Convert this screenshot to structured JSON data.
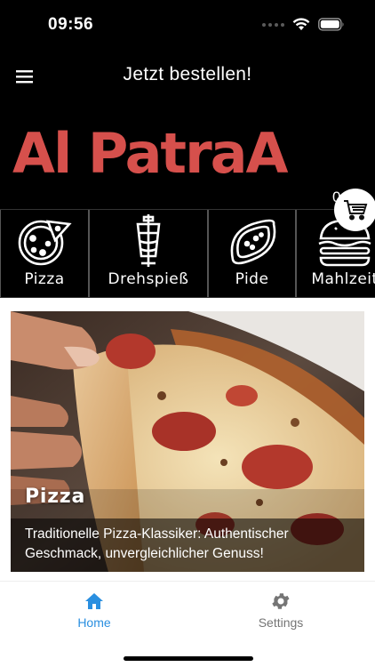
{
  "status_bar": {
    "time": "09:56"
  },
  "app_bar": {
    "title": "Jetzt bestellen!"
  },
  "brand": {
    "name": "Al PatraA",
    "color": "#d6504c"
  },
  "cart": {
    "count": "0"
  },
  "categories": [
    {
      "label": "Pizza",
      "icon": "pizza-icon"
    },
    {
      "label": "Drehspieß",
      "icon": "doner-icon"
    },
    {
      "label": "Pide",
      "icon": "pide-icon"
    },
    {
      "label": "Mahlzeit",
      "icon": "burger-icon"
    }
  ],
  "feature_card": {
    "title": "Pizza",
    "description": "Traditionelle Pizza-Klassiker: Authentischer Geschmack, unvergleichlicher Genuss!"
  },
  "bottom_nav": {
    "home_label": "Home",
    "settings_label": "Settings",
    "active_color": "#2a8fe0",
    "inactive_color": "#757575"
  }
}
